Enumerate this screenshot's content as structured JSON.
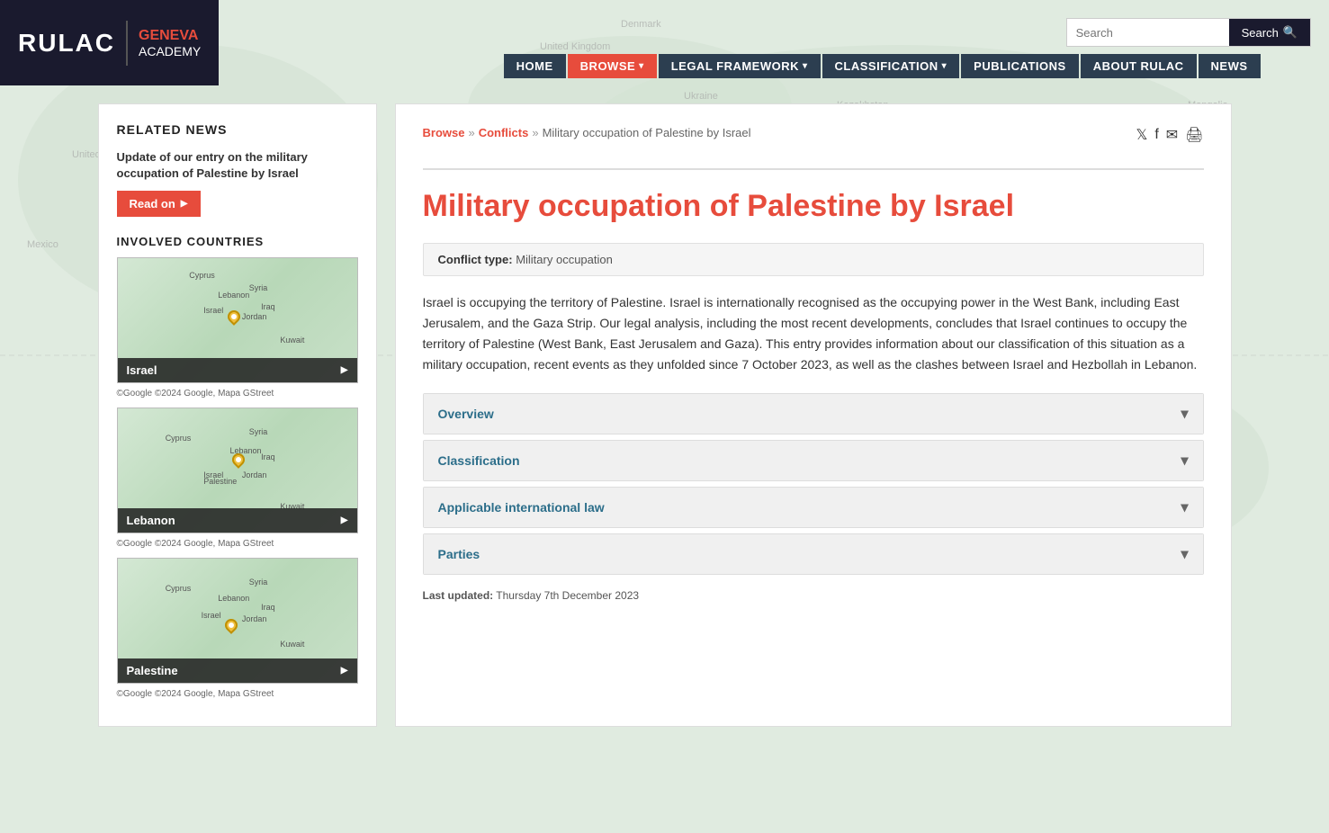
{
  "site": {
    "logo_rulac": "RULAC",
    "logo_geneva": "GENEVA",
    "logo_academy": "ACADEMY",
    "search_placeholder": "Search",
    "search_button": "Search"
  },
  "nav": {
    "items": [
      {
        "id": "home",
        "label": "HOME",
        "active": false,
        "dropdown": false
      },
      {
        "id": "browse",
        "label": "BROWSE",
        "active": true,
        "dropdown": true
      },
      {
        "id": "legal",
        "label": "LEGAL FRAMEWORK",
        "active": false,
        "dropdown": true
      },
      {
        "id": "classification",
        "label": "CLASSIFICATION",
        "active": false,
        "dropdown": true
      },
      {
        "id": "publications",
        "label": "PUBLICATIONS",
        "active": false,
        "dropdown": false
      },
      {
        "id": "about",
        "label": "ABOUT RULAC",
        "active": false,
        "dropdown": false
      },
      {
        "id": "news",
        "label": "NEWS",
        "active": false,
        "dropdown": false
      }
    ]
  },
  "sidebar": {
    "related_news_title": "RELATED NEWS",
    "news_update_text": "Update of our entry on the military occupation of Palestine by Israel",
    "read_on_label": "Read on",
    "involved_countries_title": "INVOLVED COUNTRIES",
    "countries": [
      {
        "name": "Israel",
        "pin_top": "45%",
        "pin_left": "52%"
      },
      {
        "name": "Lebanon",
        "pin_top": "40%",
        "pin_left": "50%"
      },
      {
        "name": "Palestine",
        "pin_top": "48%",
        "pin_left": "52%"
      }
    ]
  },
  "breadcrumb": {
    "browse": "Browse",
    "conflicts": "Conflicts",
    "current": "Military occupation of Palestine by Israel"
  },
  "content": {
    "title": "Military occupation of Palestine by Israel",
    "conflict_type_label": "Conflict type:",
    "conflict_type_value": "Military occupation",
    "description": "Israel is occupying the territory of Palestine. Israel is internationally recognised as the occupying power in the West Bank, including East Jerusalem, and the Gaza Strip. Our legal analysis, including the most recent developments, concludes that Israel continues to occupy the territory of Palestine (West Bank, East Jerusalem and Gaza). This entry provides information about our classification of this situation as a military occupation, recent events as they unfolded since 7 October 2023, as well as the clashes between Israel and Hezbollah in Lebanon.",
    "accordion": [
      {
        "id": "overview",
        "label": "Overview"
      },
      {
        "id": "classification",
        "label": "Classification"
      },
      {
        "id": "applicable-law",
        "label": "Applicable international law"
      },
      {
        "id": "parties",
        "label": "Parties"
      }
    ],
    "last_updated_label": "Last updated:",
    "last_updated_value": "Thursday 7th December 2023"
  }
}
